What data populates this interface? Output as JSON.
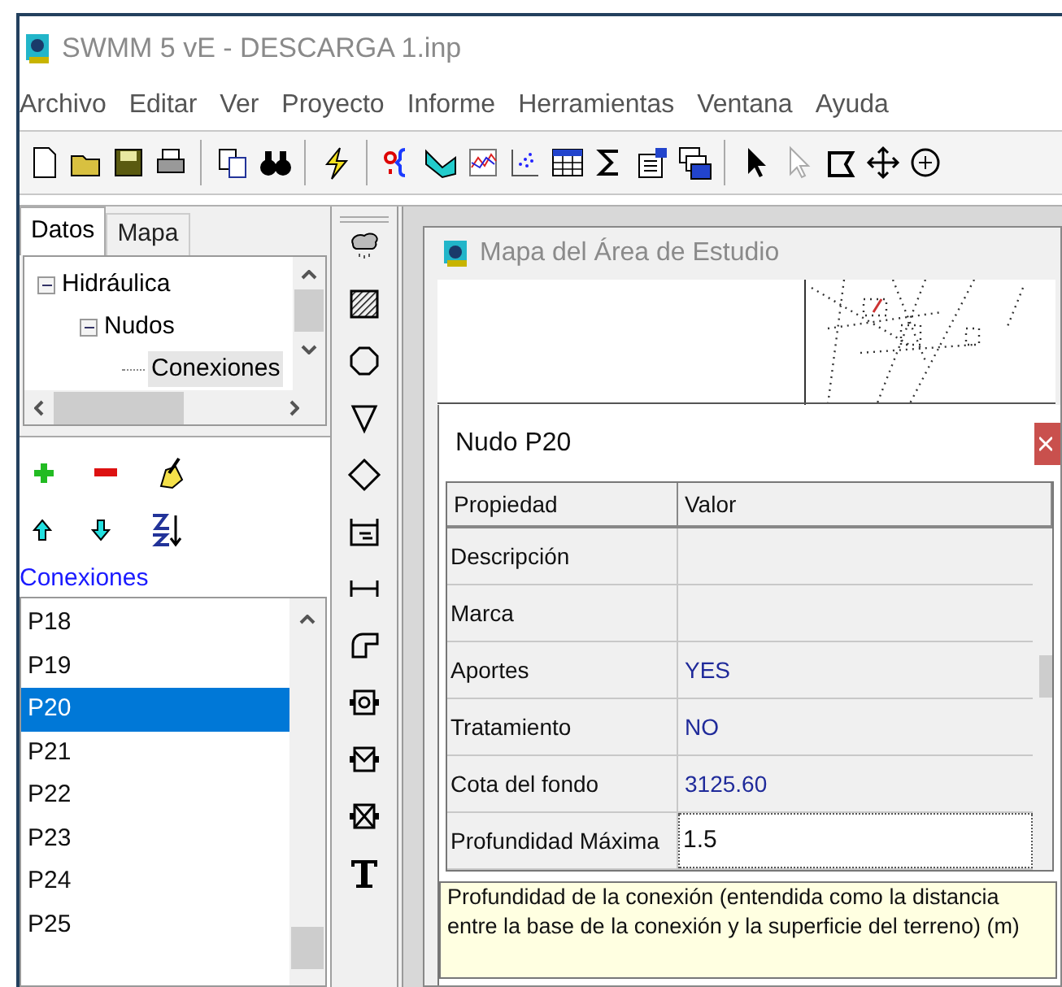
{
  "window": {
    "title": "SWMM 5 vE - DESCARGA 1.inp"
  },
  "menu": [
    "Archivo",
    "Editar",
    "Ver",
    "Proyecto",
    "Informe",
    "Herramientas",
    "Ventana",
    "Ayuda"
  ],
  "tabs": [
    {
      "label": "Datos",
      "selected": true
    },
    {
      "label": "Mapa",
      "selected": false
    }
  ],
  "tree": [
    {
      "label": "Hidráulica",
      "expanded": true,
      "selected": false,
      "children": [
        {
          "label": "Nudos",
          "expanded": true,
          "selected": false,
          "children": [
            {
              "label": "Conexiones",
              "selected": true
            }
          ]
        }
      ]
    }
  ],
  "object_list": {
    "title": "Conexiones",
    "items": [
      {
        "label": "P18",
        "selected": false
      },
      {
        "label": "P19",
        "selected": false
      },
      {
        "label": "P20",
        "selected": true
      },
      {
        "label": "P21",
        "selected": false
      },
      {
        "label": "P22",
        "selected": false
      },
      {
        "label": "P23",
        "selected": false
      },
      {
        "label": "P24",
        "selected": false
      },
      {
        "label": "P25",
        "selected": false
      }
    ]
  },
  "map_window": {
    "title": "Mapa del Área de Estudio"
  },
  "property_editor": {
    "title": "Nudo P20",
    "columns": [
      "Propiedad",
      "Valor"
    ],
    "rows": [
      {
        "name": "Descripción",
        "editing": false
      },
      {
        "name": "Marca",
        "editing": false
      },
      {
        "name": "Aportes",
        "value": "YES",
        "editing": false
      },
      {
        "name": "Tratamiento",
        "value": "NO",
        "editing": false
      },
      {
        "name": "Cota del fondo",
        "value": "3125.60",
        "editing": false
      },
      {
        "name": "Profundidad Máxima",
        "value": "1.5",
        "editing": true
      }
    ],
    "hint": "Profundidad de la conexión (entendida como la distancia entre la base de la conexión y la superficie del terreno) (m)"
  }
}
